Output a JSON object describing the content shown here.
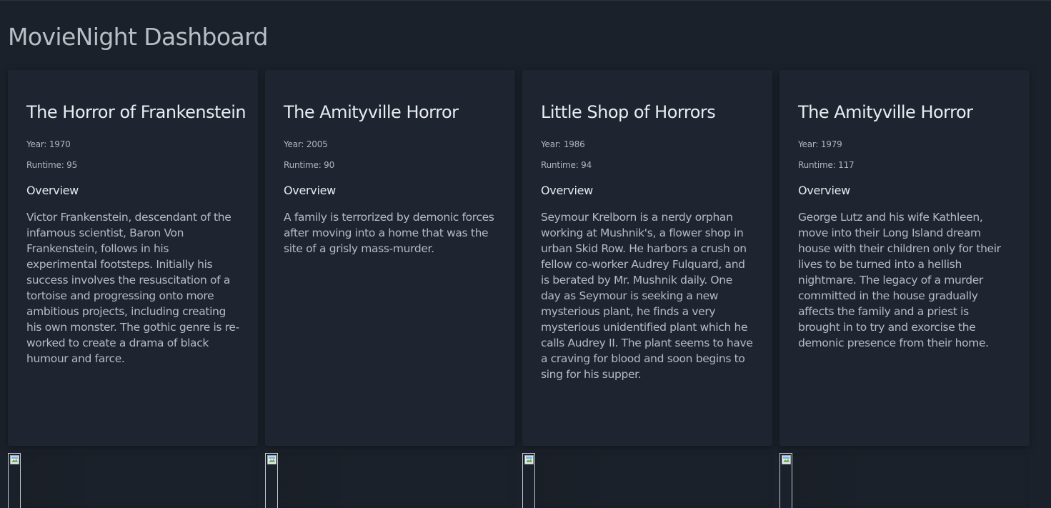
{
  "header": {
    "title": "MovieNight Dashboard"
  },
  "labels": {
    "year_prefix": "Year: ",
    "runtime_prefix": "Runtime: ",
    "overview_heading": "Overview"
  },
  "movies": [
    {
      "title": "The Horror of Frankenstein",
      "year": "Year: 1970",
      "runtime": "Runtime: 95",
      "overview_heading": "Overview",
      "overview": "Victor Frankenstein, descendant of the infamous scientist, Baron Von Frankenstein, follows in his experimental footsteps. Initially his success involves the resuscitation of a tortoise and progressing onto more ambitious projects, including creating his own monster. The gothic genre is re-worked to create a drama of black humour and farce."
    },
    {
      "title": "The Amityville Horror",
      "year": "Year: 2005",
      "runtime": "Runtime: 90",
      "overview_heading": "Overview",
      "overview": "A family is terrorized by demonic forces after moving into a home that was the site of a grisly mass-murder."
    },
    {
      "title": "Little Shop of Horrors",
      "year": "Year: 1986",
      "runtime": "Runtime: 94",
      "overview_heading": "Overview",
      "overview": "Seymour Krelborn is a nerdy orphan working at Mushnik's, a flower shop in urban Skid Row. He harbors a crush on fellow co-worker Audrey Fulquard, and is berated by Mr. Mushnik daily. One day as Seymour is seeking a new mysterious plant, he finds a very mysterious unidentified plant which he calls Audrey II. The plant seems to have a craving for blood and soon begins to sing for his supper."
    },
    {
      "title": "The Amityville Horror",
      "year": "Year: 1979",
      "runtime": "Runtime: 117",
      "overview_heading": "Overview",
      "overview": "George Lutz and his wife Kathleen, move into their Long Island dream house with their children only for their lives to be turned into a hellish nightmare. The legacy of a murder committed in the house gradually affects the family and a priest is brought in to try and exorcise the demonic presence from their home."
    }
  ],
  "posters": [
    {
      "icon": "broken-image-icon"
    },
    {
      "icon": "broken-image-icon"
    },
    {
      "icon": "broken-image-icon"
    },
    {
      "icon": "broken-image-icon"
    }
  ],
  "colors": {
    "background": "#1b212a",
    "card": "#1e2530",
    "title_text": "#e9ecf0",
    "body_text": "#b6bbc3"
  }
}
